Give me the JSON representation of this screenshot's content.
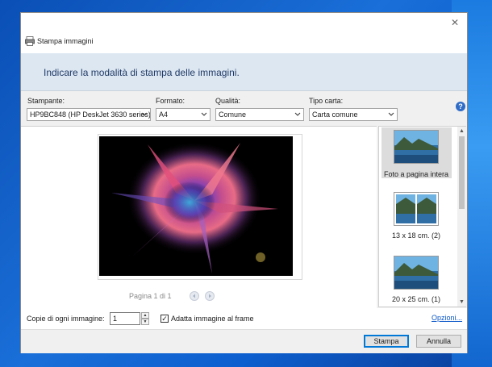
{
  "window": {
    "title": "Stampa immagini"
  },
  "header": {
    "instruction": "Indicare la modalità di stampa delle immagini."
  },
  "settings": {
    "printer": {
      "label": "Stampante:",
      "value": "HP9BC848 (HP DeskJet 3630 series)"
    },
    "format": {
      "label": "Formato:",
      "value": "A4"
    },
    "quality": {
      "label": "Qualità:",
      "value": "Comune"
    },
    "paper_type": {
      "label": "Tipo carta:",
      "value": "Carta comune"
    }
  },
  "preview": {
    "page_indicator": "Pagina 1 di 1"
  },
  "layouts": [
    {
      "label": "Foto a pagina intera",
      "selected": true
    },
    {
      "label": "13 x 18 cm. (2)",
      "selected": false
    },
    {
      "label": "20 x 25 cm. (1)",
      "selected": false
    }
  ],
  "options_bar": {
    "copies_label": "Copie di ogni immagine:",
    "copies_value": "1",
    "fit_label": "Adatta immagine al frame",
    "fit_checked": true,
    "options_link": "Opzioni..."
  },
  "footer": {
    "print_button": "Stampa",
    "cancel_button": "Annulla"
  },
  "icons": {
    "app": "printer-icon",
    "close": "close-icon",
    "help": "help-icon",
    "prev": "previous-page-icon",
    "next": "next-page-icon"
  },
  "colors": {
    "header_band": "#dde7f2",
    "header_text": "#1f3a66",
    "link": "#0b57c7",
    "accent": "#0078d7"
  }
}
